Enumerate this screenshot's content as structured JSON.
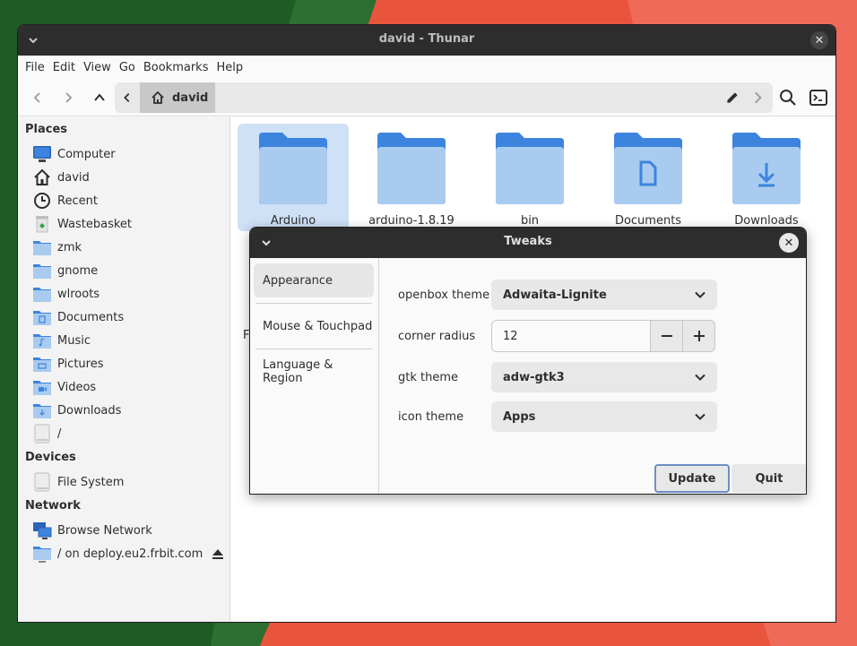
{
  "colors": {
    "accent": "#3584e4",
    "folder": "#a9cbf0",
    "folder_tab": "#3d84de",
    "titlebar": "#2d2d2d",
    "selection": "#cfe1f7"
  },
  "thunar": {
    "title": "david - Thunar",
    "menu": [
      "File",
      "Edit",
      "View",
      "Go",
      "Bookmarks",
      "Help"
    ],
    "path": {
      "home_label": "david"
    },
    "sidebar": {
      "places_heading": "Places",
      "places": [
        {
          "label": "Computer",
          "icon": "computer-icon"
        },
        {
          "label": "david",
          "icon": "home-icon"
        },
        {
          "label": "Recent",
          "icon": "clock-icon"
        },
        {
          "label": "Wastebasket",
          "icon": "trash-icon"
        },
        {
          "label": "zmk",
          "icon": "folder-icon"
        },
        {
          "label": "gnome",
          "icon": "folder-icon"
        },
        {
          "label": "wlroots",
          "icon": "folder-icon"
        },
        {
          "label": "Documents",
          "icon": "folder-documents-icon"
        },
        {
          "label": "Music",
          "icon": "folder-music-icon"
        },
        {
          "label": "Pictures",
          "icon": "folder-pictures-icon"
        },
        {
          "label": "Videos",
          "icon": "folder-videos-icon"
        },
        {
          "label": "Downloads",
          "icon": "folder-downloads-icon"
        },
        {
          "label": "/",
          "icon": "drive-icon"
        }
      ],
      "devices_heading": "Devices",
      "devices": [
        {
          "label": "File System",
          "icon": "drive-icon"
        }
      ],
      "network_heading": "Network",
      "network": [
        {
          "label": "Browse Network",
          "icon": "network-icon"
        },
        {
          "label": "/ on deploy.eu2.frbit.com",
          "icon": "remote-folder-icon"
        }
      ]
    },
    "files": [
      {
        "label": "Arduino",
        "icon": "folder-icon",
        "selected": true
      },
      {
        "label": "arduino-1.8.19",
        "icon": "folder-icon"
      },
      {
        "label": "bin",
        "icon": "folder-icon"
      },
      {
        "label": "Documents",
        "icon": "folder-documents-icon"
      },
      {
        "label": "Downloads",
        "icon": "folder-downloads-icon"
      }
    ],
    "partial_label": "F"
  },
  "tweaks": {
    "title": "Tweaks",
    "nav": [
      "Appearance",
      "Mouse & Touchpad",
      "Language & Region"
    ],
    "openbox_theme": {
      "label": "openbox theme",
      "value": "Adwaita-Lignite"
    },
    "corner_radius": {
      "label": "corner radius",
      "value": "12"
    },
    "gtk_theme": {
      "label": "gtk theme",
      "value": "adw-gtk3"
    },
    "icon_theme": {
      "label": "icon theme",
      "value": "Apps"
    },
    "update_label": "Update",
    "quit_label": "Quit"
  }
}
